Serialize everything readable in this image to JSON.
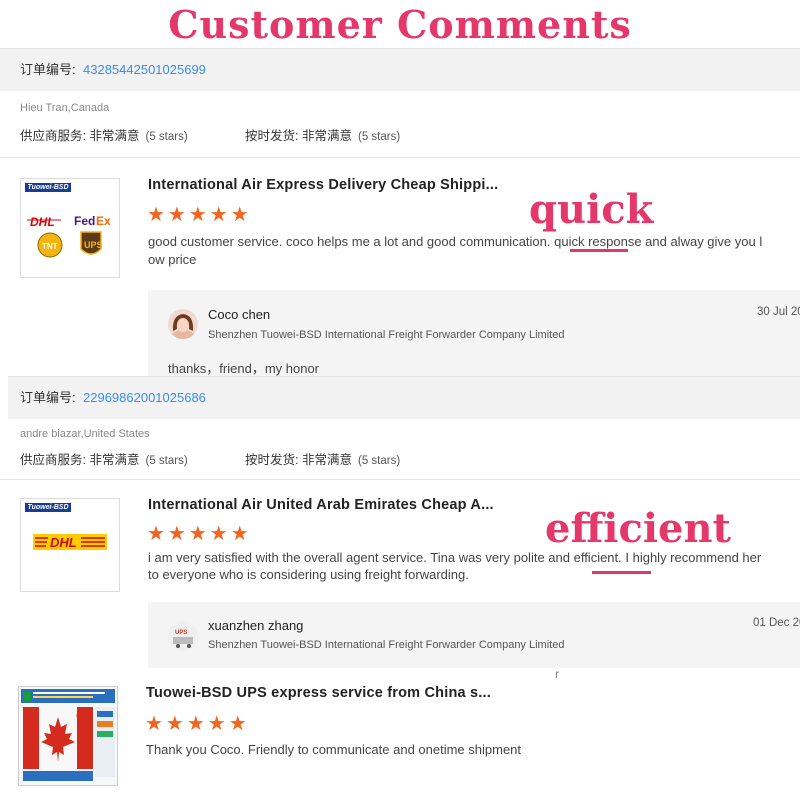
{
  "header": {
    "title": "Customer Comments"
  },
  "overlays": {
    "word1": "quick",
    "word2": "efficient"
  },
  "orders": [
    {
      "order_label": "订单编号:",
      "order_number": "43285442501025699",
      "buyer": "Hieu Tran,Canada",
      "supplier_label": "供应商服务:",
      "supplier_value": "非常满意",
      "supplier_stars": "(5 stars)",
      "ontime_label": "按时发货:",
      "ontime_value": "非常满意",
      "ontime_stars": "(5 stars)",
      "product_title": "International Air Express Delivery Cheap Shippi...",
      "stars": "★★★★★",
      "comment_line1": "good customer service. coco helps me a lot and good communication. quick response and alway give you l",
      "comment_line2": "ow price",
      "thumb_brand": "Tuowei-BSD",
      "thumb_logos": [
        "DHL",
        "FedEx",
        "TNT",
        "UPS"
      ],
      "reply": {
        "name": "Coco chen",
        "company": "Shenzhen Tuowei-BSD International Freight Forwarder Company Limited",
        "date": "30 Jul 20",
        "text": "thanks，friend，my honor"
      }
    },
    {
      "order_label": "订单编号:",
      "order_number": "22969862001025686",
      "buyer": "andre biazar,United States",
      "supplier_label": "供应商服务:",
      "supplier_value": "非常满意",
      "supplier_stars": "(5 stars)",
      "ontime_label": "按时发货:",
      "ontime_value": "非常满意",
      "ontime_stars": "(5 stars)",
      "product_title": "International Air United Arab Emirates Cheap A...",
      "stars": "★★★★★",
      "comment_line1": "i am very satisfied with the overall agent service. Tina was very polite and efficient. I highly recommend her",
      "comment_line2": "to everyone who is considering using freight forwarding.",
      "thumb_brand": "Tuowei-BSD",
      "thumb_logos": [
        "DHL"
      ],
      "reply": {
        "name": "xuanzhen zhang",
        "company": "Shenzhen Tuowei-BSD International Freight Forwarder Company Limited",
        "date": "01 Dec 20",
        "text": "r"
      }
    },
    {
      "product_title": "Tuowei-BSD UPS express service from China s...",
      "stars": "★★★★★",
      "comment_line1": "Thank you Coco. Friendly to communicate and onetime shipment",
      "thumb_text": "Ca"
    }
  ],
  "colors": {
    "accent": "#e5386a",
    "star": "#f5641e",
    "link": "#3a8ee6"
  }
}
